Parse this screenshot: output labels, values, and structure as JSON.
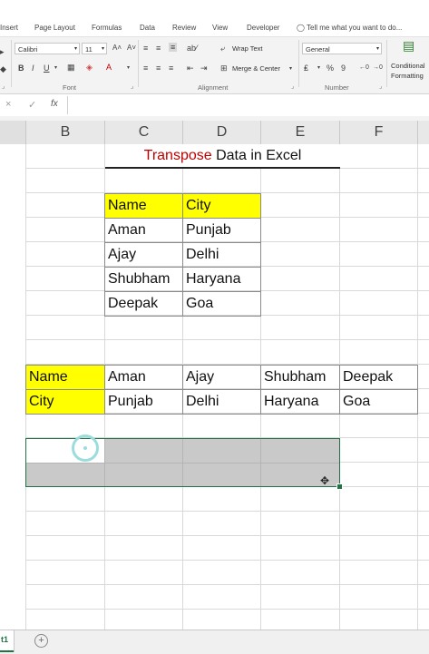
{
  "ribbon": {
    "tabs": [
      "Insert",
      "Page Layout",
      "Formulas",
      "Data",
      "Review",
      "View",
      "Developer"
    ],
    "tell_me": "Tell me what you want to do...",
    "font_name": "Calibri",
    "font_size": "11",
    "wrap_text": "Wrap Text",
    "merge_center": "Merge & Center",
    "number_format": "General",
    "conditional_formatting_line1": "Conditional",
    "conditional_formatting_line2": "Formatting",
    "group_font": "Font",
    "group_alignment": "Alignment",
    "group_number": "Number",
    "bold": "B",
    "italic": "I",
    "underline": "U",
    "percent": "%",
    "comma": "9"
  },
  "formula_bar": {
    "cancel": "×",
    "enter": "✓",
    "function": "fx"
  },
  "columns": [
    "B",
    "C",
    "D",
    "E",
    "F"
  ],
  "sheet": {
    "title_part1": "Transpose",
    "title_part2": " Data in Excel",
    "title_color": "#c00000",
    "header_fill": "#ffff00",
    "source_table": {
      "headers": [
        "Name",
        "City"
      ],
      "rows": [
        [
          "Aman",
          "Punjab"
        ],
        [
          "Ajay",
          "Delhi"
        ],
        [
          "Shubham",
          "Haryana"
        ],
        [
          "Deepak",
          "Goa"
        ]
      ]
    },
    "transposed": {
      "row1": [
        "Name",
        "Aman",
        "Ajay",
        "Shubham",
        "Deepak"
      ],
      "row2": [
        "City",
        "Punjab",
        "Delhi",
        "Haryana",
        "Goa"
      ]
    }
  },
  "sheet_tabs": {
    "active": "t1",
    "add": "+"
  }
}
